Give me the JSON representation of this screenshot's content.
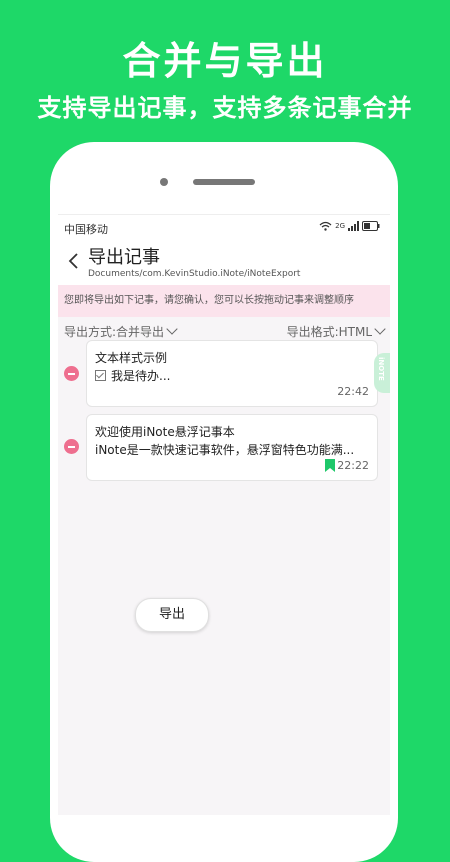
{
  "promo": {
    "title": "合并与导出",
    "subtitle": "支持导出记事，支持多条记事合并"
  },
  "statusbar": {
    "carrier": "中国移动",
    "network": "2G"
  },
  "appbar": {
    "title": "导出记事",
    "path": "Documents/com.KevinStudio.iNote/iNoteExport"
  },
  "notice": "您即将导出如下记事，请您确认，您可以长按拖动记事来调整顺序",
  "options": {
    "mode": "导出方式:合并导出",
    "format": "导出格式:HTML"
  },
  "notes": [
    {
      "title": "文本样式示例",
      "preview": "我是待办...",
      "time": "22:42"
    },
    {
      "title": "欢迎使用iNote悬浮记事本",
      "preview": "iNote是一款快速记事软件，悬浮窗特色功能满...",
      "time": "22:22"
    }
  ],
  "side_tab": "iNOTE",
  "export_button": "导出",
  "colors": {
    "background": "#1ed868",
    "notice_bg": "#fbe3ec",
    "remove": "#ee6f8f",
    "bookmark": "#1ec86a"
  }
}
